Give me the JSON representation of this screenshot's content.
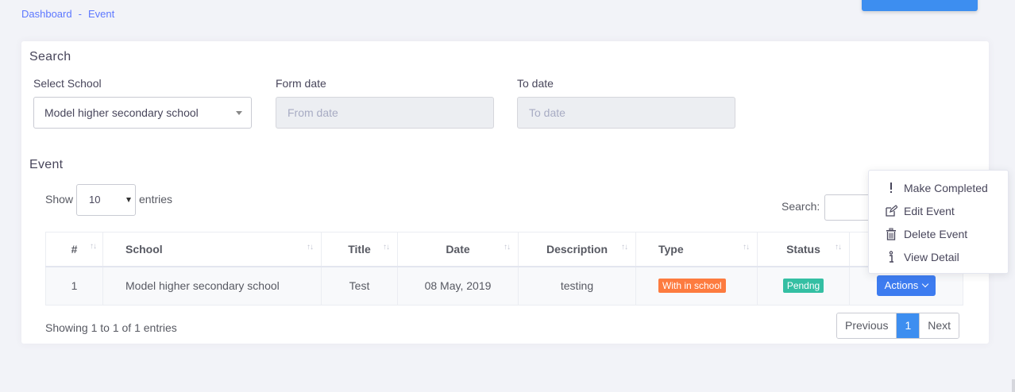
{
  "breadcrumb": {
    "items": [
      "Dashboard",
      "Event"
    ],
    "separator": "-"
  },
  "search_section": {
    "title": "Search",
    "school_label": "Select School",
    "school_value": "Model higher secondary school",
    "from_label": "Form date",
    "from_placeholder": "From date",
    "to_label": "To date",
    "to_placeholder": "To date"
  },
  "event_section": {
    "title": "Event",
    "show_label": "Show",
    "entries_value": "10",
    "entries_label": "entries",
    "search_label": "Search:",
    "columns": [
      "#",
      "School",
      "Title",
      "Date",
      "Description",
      "Type",
      "Status"
    ],
    "rows": [
      {
        "num": "1",
        "school": "Model higher secondary school",
        "title": "Test",
        "date": "08 May, 2019",
        "description": "testing",
        "type": "With in school",
        "status": "Pendng",
        "action": "Actions"
      }
    ],
    "info": "Showing 1 to 1 of 1 entries",
    "pagination": {
      "previous": "Previous",
      "current": "1",
      "next": "Next"
    }
  },
  "actions_menu": {
    "items": [
      "Make Completed",
      "Edit Event",
      "Delete Event",
      "View Detail"
    ]
  },
  "colors": {
    "accent": "#3d8ef0",
    "type_badge": "#fd7b3f",
    "status_badge": "#34bfa3",
    "breadcrumb": "#5d78ff"
  }
}
